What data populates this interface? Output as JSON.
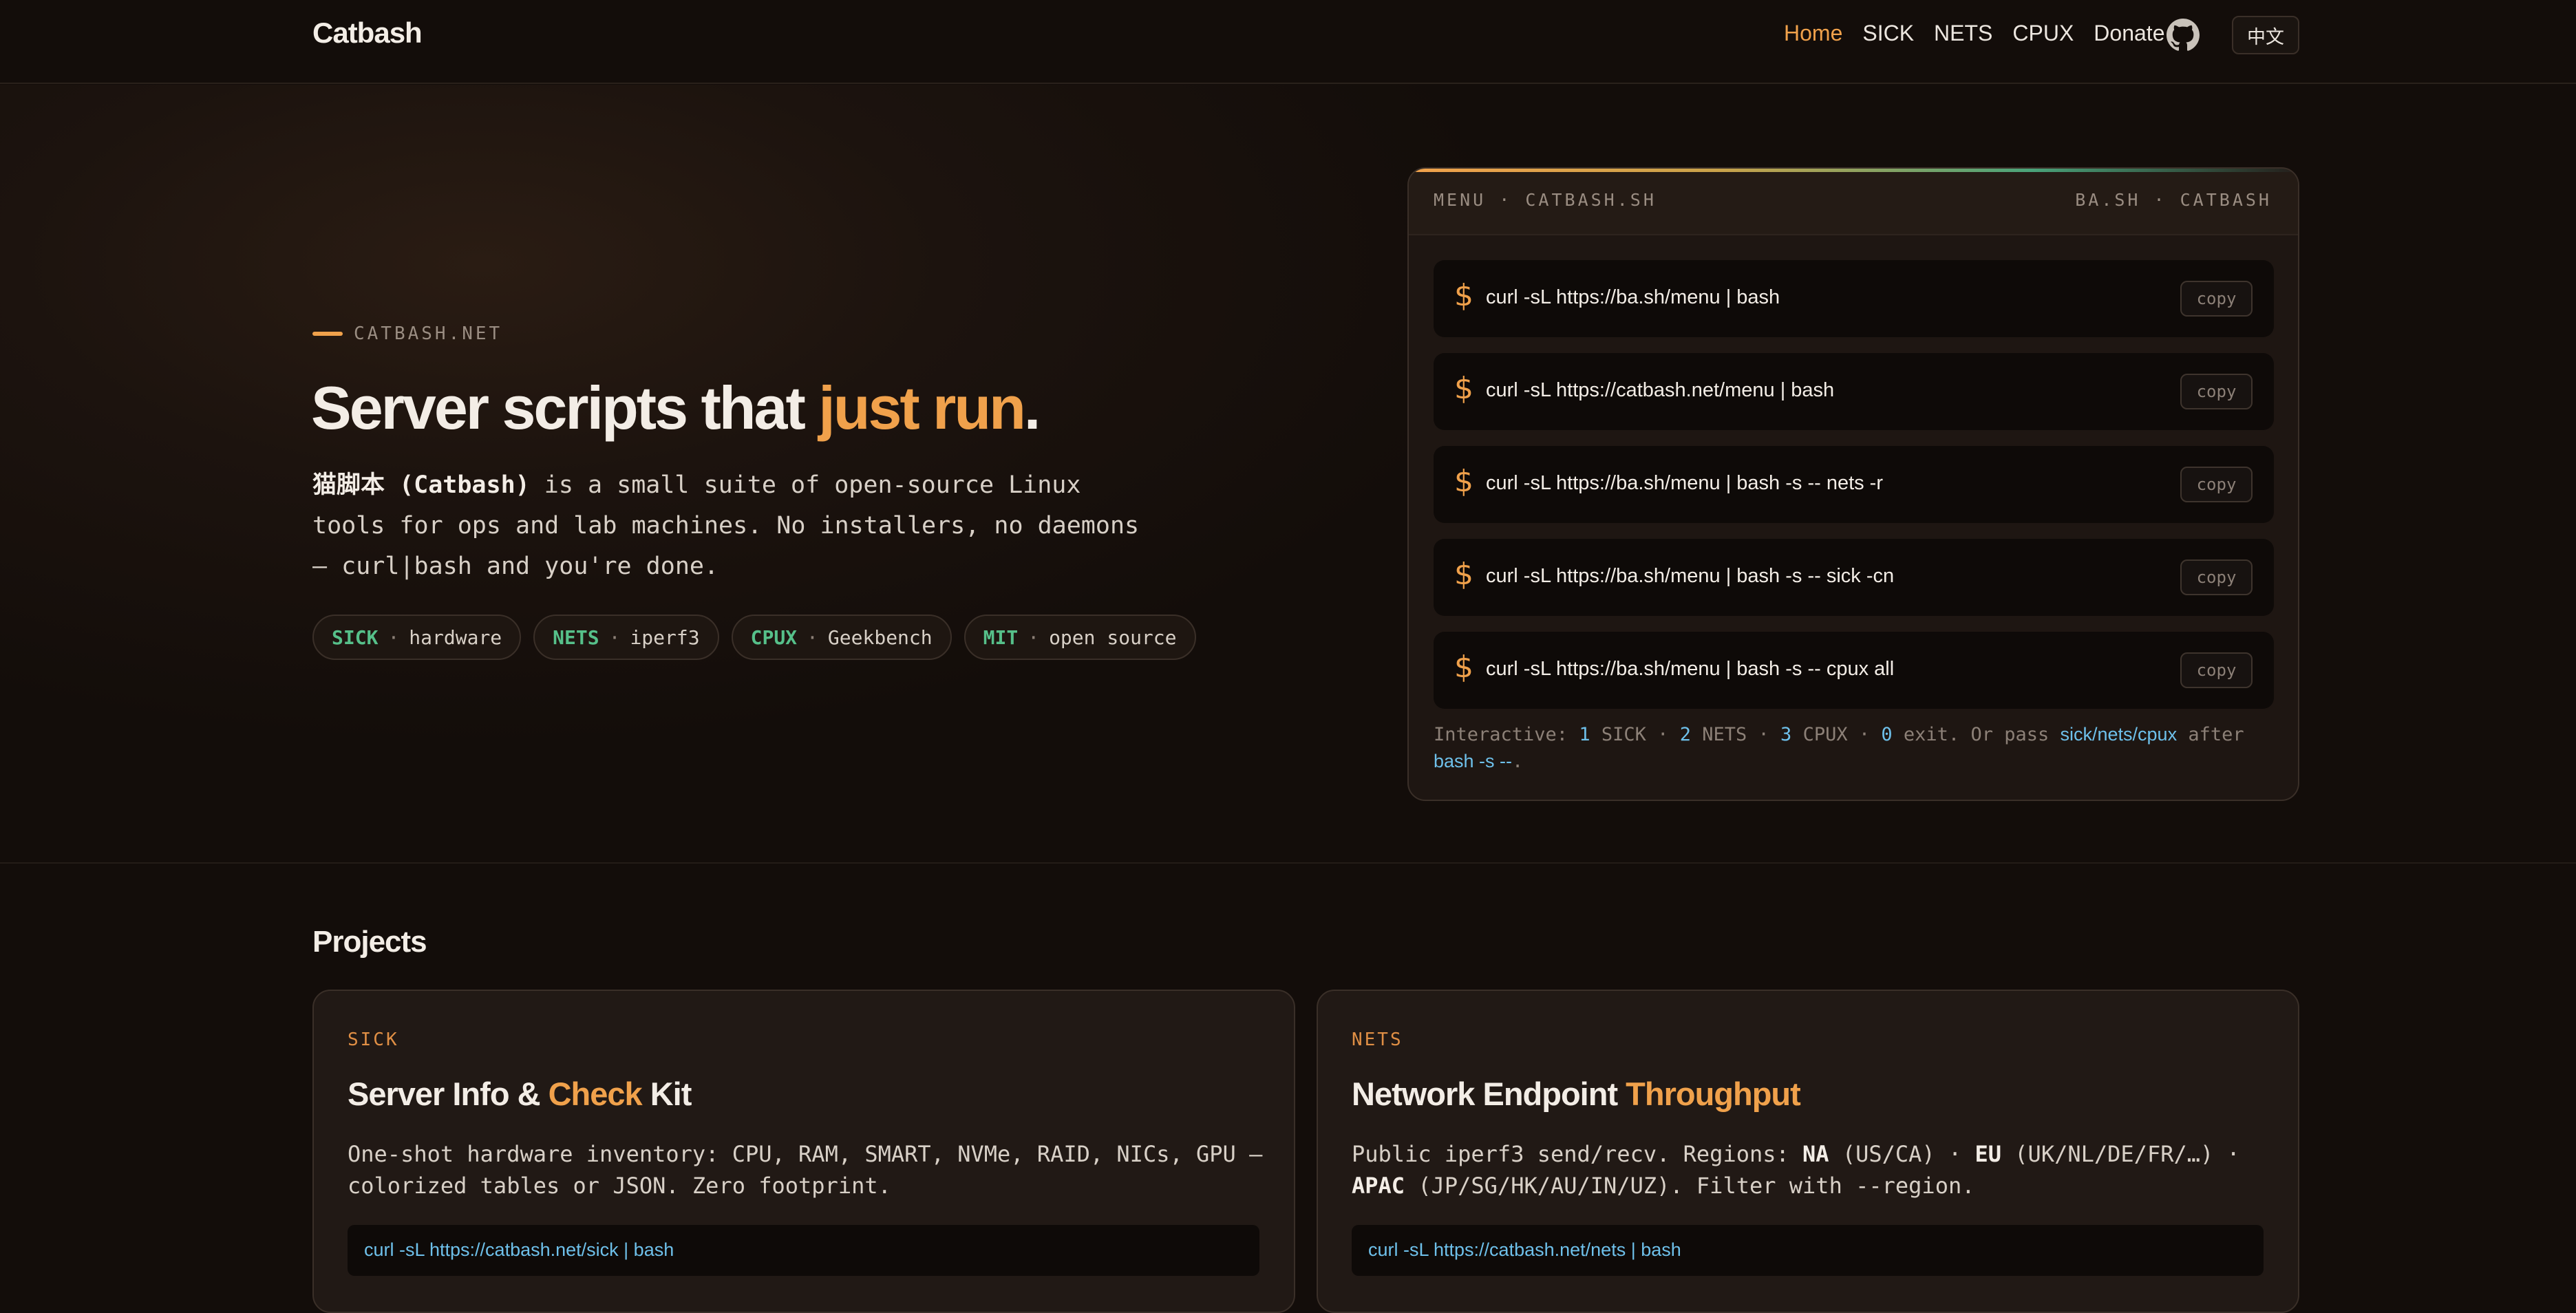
{
  "nav": {
    "brand": "Catbash",
    "links": [
      "Home",
      "SICK",
      "NETS",
      "CPUX",
      "Donate"
    ],
    "active": "Home",
    "github_icon": "github-icon",
    "lang_label": "中文"
  },
  "hero": {
    "eyebrow": "CATBASH.NET",
    "title_start": "Server scripts that ",
    "title_accent": "just run",
    "title_end": ".",
    "desc_name": "猫脚本 (Catbash)",
    "desc_rest": " is a small suite of open-source Linux tools for ops and lab machines. No installers, no daemons — ",
    "desc_code": "curl|bash",
    "desc_end": " and you're done.",
    "tags": [
      {
        "key": "SICK",
        "sep": "·",
        "value": "hardware"
      },
      {
        "key": "NETS",
        "sep": "·",
        "value": "iperf3"
      },
      {
        "key": "CPUX",
        "sep": "·",
        "value": "Geekbench"
      },
      {
        "key": "MIT",
        "sep": "·",
        "value": "open source"
      }
    ]
  },
  "terminal": {
    "header_left": "MENU · CATBASH.SH",
    "header_right": "BA.SH · CATBASH",
    "prompt": "$",
    "copy_label": "copy",
    "commands": [
      "curl -sL https://ba.sh/menu | bash",
      "curl -sL https://catbash.net/menu | bash",
      "curl -sL https://ba.sh/menu | bash -s -- nets -r",
      "curl -sL https://ba.sh/menu | bash -s -- sick -cn",
      "curl -sL https://ba.sh/menu | bash -s -- cpux all"
    ],
    "footer": {
      "interactive": "Interactive:",
      "n1": "1",
      "l1": "SICK",
      "n2": "2",
      "l2": "NETS",
      "n3": "3",
      "l3": "CPUX",
      "n0": "0",
      "l0": "exit. Or pass",
      "args": "sick/nets/cpux",
      "after": "after",
      "flag": "bash -s --",
      "period": "."
    }
  },
  "projects": {
    "heading": "Projects",
    "cards": [
      {
        "label": "SICK",
        "title_a": "Server Info & ",
        "title_accent": "Check",
        "title_b": " Kit",
        "desc": "One-shot hardware inventory: CPU, RAM, SMART, NVMe, RAID, NICs, GPU — colorized tables or JSON. Zero footprint.",
        "cmd": "curl -sL https://catbash.net/sick | bash"
      },
      {
        "label": "NETS",
        "title_a": "Network Endpoint ",
        "title_accent": "Throughput",
        "title_b": "",
        "desc_1": "Public iperf3 send/recv. Regions: ",
        "desc_na": "NA",
        "desc_2": " (US/CA) · ",
        "desc_eu": "EU",
        "desc_3": " (UK/NL/DE/FR/…) · ",
        "desc_apac": "APAC",
        "desc_4": " (JP/SG/HK/AU/IN/UZ). Filter with --region.",
        "cmd": "curl -sL https://catbash.net/nets | bash"
      }
    ]
  },
  "colors": {
    "accent": "#f0a14b",
    "tag_key": "#56c08a",
    "link": "#6ec0ea",
    "background": "#130d0a"
  }
}
